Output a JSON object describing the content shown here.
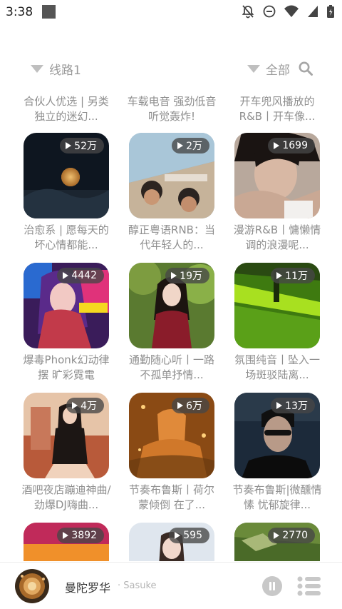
{
  "status_bar": {
    "time": "3:38"
  },
  "filters": {
    "route_label": "线路1",
    "category_label": "全部"
  },
  "partial_titles": [
    "合伙人优选 | 另类独立的迷幻...",
    "车载电音 强劲低音 听觉轰炸!",
    "开车兜风播放的R&B丨开车像..."
  ],
  "playlists": [
    {
      "title": "治愈系 | 愿每天的坏心情都能...",
      "plays": "52万"
    },
    {
      "title": "醇正粤语RNB：当代年轻人的...",
      "plays": "2万"
    },
    {
      "title": "漫游R&B丨慵懒情调的浪漫呢...",
      "plays": "1699"
    },
    {
      "title": "爆毒Phonk幻动律摆 旷彩霓電",
      "plays": "4442"
    },
    {
      "title": "通勤随心听丨一路不孤单抒情...",
      "plays": "19万"
    },
    {
      "title": "氛围纯音丨坠入一场斑驳陆离...",
      "plays": "11万"
    },
    {
      "title": "酒吧夜店蹦迪神曲/劲爆DJ嗨曲...",
      "plays": "4万"
    },
    {
      "title": "节奏布鲁斯丨荷尔蒙倾倒 在了...",
      "plays": "6万"
    },
    {
      "title": "节奏布鲁斯|微醺情愫 忧郁旋律...",
      "plays": "13万"
    },
    {
      "title": "",
      "plays": "3892"
    },
    {
      "title": "",
      "plays": "595"
    },
    {
      "title": "",
      "plays": "2770"
    }
  ],
  "player": {
    "song_title": "曼陀罗华",
    "artist": "· Sasuke"
  },
  "icons": {
    "search": "search-icon",
    "dropdown": "triangle-down-icon",
    "play": "play-icon",
    "pause": "pause-icon",
    "list": "playlist-icon"
  }
}
